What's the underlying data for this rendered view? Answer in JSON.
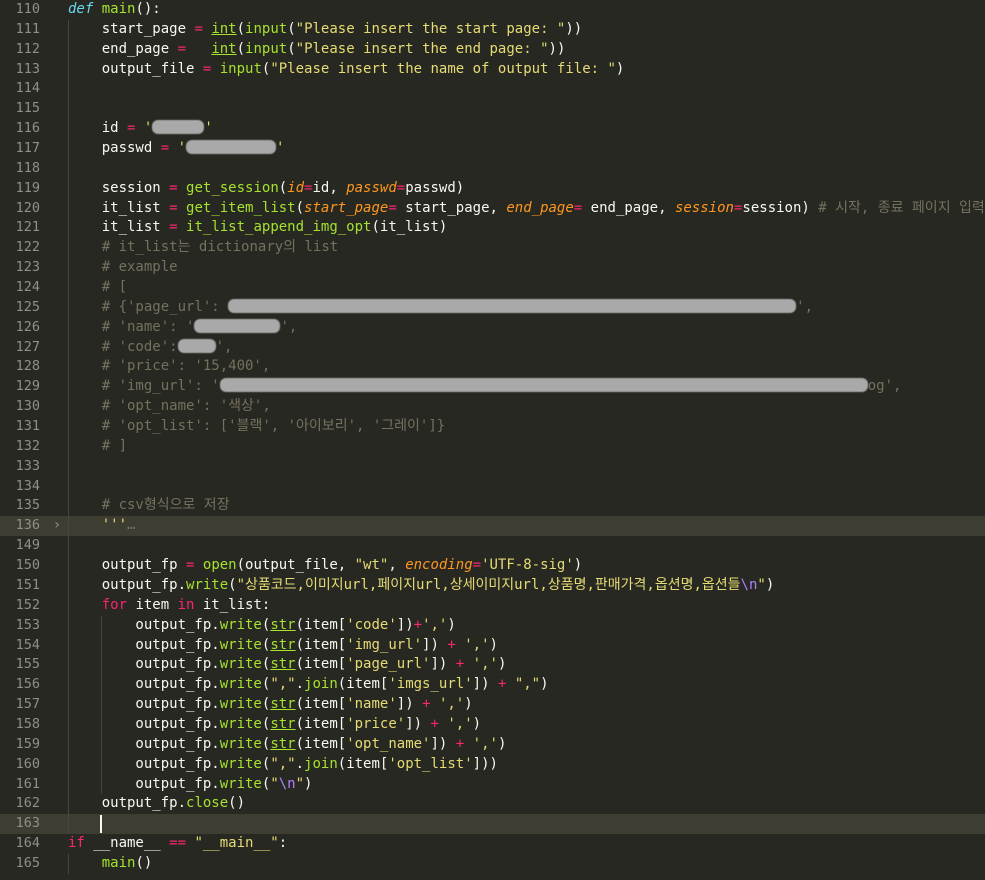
{
  "editor": {
    "first_line": "110",
    "lines": [
      {
        "n": "110",
        "t": [
          [
            "def",
            "kw-i"
          ],
          " ",
          [
            "main",
            "fn"
          ],
          "():"
        ]
      },
      {
        "n": "111",
        "t": [
          "    start_page ",
          [
            "=",
            "op"
          ],
          " ",
          [
            "int",
            "fn ul"
          ],
          "(",
          [
            "input",
            "fn"
          ],
          "(",
          [
            "\"Please insert the start page: \"",
            "str"
          ],
          "))"
        ]
      },
      {
        "n": "112",
        "t": [
          "    end_page ",
          [
            "=",
            "op"
          ],
          "   ",
          [
            "int",
            "fn ul"
          ],
          "(",
          [
            "input",
            "fn"
          ],
          "(",
          [
            "\"Please insert the end page: \"",
            "str"
          ],
          "))"
        ]
      },
      {
        "n": "113",
        "t": [
          "    output_file ",
          [
            "=",
            "op"
          ],
          " ",
          [
            "input",
            "fn"
          ],
          "(",
          [
            "\"Please insert the name of output file: \"",
            "str"
          ],
          ")"
        ]
      },
      {
        "n": "114",
        "t": []
      },
      {
        "n": "115",
        "t": []
      },
      {
        "n": "116",
        "t": [
          "    id ",
          [
            "=",
            "op"
          ],
          " ",
          [
            "'",
            "str"
          ],
          [
            "#R52",
            ""
          ],
          [
            "'",
            "str"
          ]
        ]
      },
      {
        "n": "117",
        "t": [
          "    passwd ",
          [
            "=",
            "op"
          ],
          " ",
          [
            "'",
            "str"
          ],
          [
            "#R90",
            ""
          ],
          [
            "'",
            "str"
          ]
        ]
      },
      {
        "n": "118",
        "t": []
      },
      {
        "n": "119",
        "t": [
          "    session ",
          [
            "=",
            "op"
          ],
          " ",
          [
            "get_session",
            "fn"
          ],
          "(",
          [
            "id",
            "arg"
          ],
          [
            "=",
            "op"
          ],
          "id, ",
          [
            "passwd",
            "arg"
          ],
          [
            "=",
            "op"
          ],
          "passwd)"
        ]
      },
      {
        "n": "120",
        "t": [
          "    it_list ",
          [
            "=",
            "op"
          ],
          " ",
          [
            "get_item_list",
            "fn"
          ],
          "(",
          [
            "start_page",
            "arg"
          ],
          [
            "=",
            "op"
          ],
          " start_page, ",
          [
            "end_page",
            "arg"
          ],
          [
            "=",
            "op"
          ],
          " end_page, ",
          [
            "session",
            "arg"
          ],
          [
            "=",
            "op"
          ],
          "session) ",
          [
            "# 시작, 종료 페이지 입력",
            "cm"
          ]
        ]
      },
      {
        "n": "121",
        "t": [
          "    it_list ",
          [
            "=",
            "op"
          ],
          " ",
          [
            "it_list_append_img_opt",
            "fn"
          ],
          "(it_list)"
        ]
      },
      {
        "n": "122",
        "t": [
          "    ",
          [
            "# it_list는 dictionary의 list",
            "cm"
          ]
        ]
      },
      {
        "n": "123",
        "t": [
          "    ",
          [
            "# example",
            "cm"
          ]
        ]
      },
      {
        "n": "124",
        "t": [
          "    ",
          [
            "# [",
            "cm"
          ]
        ]
      },
      {
        "n": "125",
        "t": [
          "    ",
          [
            "# {'page_url': ",
            "cm"
          ],
          [
            "#R568",
            ""
          ],
          [
            "',",
            "cm"
          ]
        ]
      },
      {
        "n": "126",
        "t": [
          "    ",
          [
            "# 'name': '",
            "cm"
          ],
          [
            "#R86",
            ""
          ],
          [
            "',",
            "cm"
          ]
        ]
      },
      {
        "n": "127",
        "t": [
          "    ",
          [
            "# 'code':",
            "cm"
          ],
          [
            "#R38",
            ""
          ],
          [
            "',",
            "cm"
          ]
        ]
      },
      {
        "n": "128",
        "t": [
          "    ",
          [
            "# 'price': '15,400',",
            "cm"
          ]
        ]
      },
      {
        "n": "129",
        "t": [
          "    ",
          [
            "# 'img_url': '",
            "cm"
          ],
          [
            "#R648",
            ""
          ],
          [
            "og',",
            "cm"
          ]
        ]
      },
      {
        "n": "130",
        "t": [
          "    ",
          [
            "# 'opt_name': '색상',",
            "cm"
          ]
        ]
      },
      {
        "n": "131",
        "t": [
          "    ",
          [
            "# 'opt_list': ['블랙', '아이보리', '그레이']}",
            "cm"
          ]
        ]
      },
      {
        "n": "132",
        "t": [
          "    ",
          [
            "# ]",
            "cm"
          ]
        ]
      },
      {
        "n": "133",
        "t": []
      },
      {
        "n": "134",
        "t": []
      },
      {
        "n": "135",
        "t": [
          "    ",
          [
            "# csv형식으로 저장",
            "cm"
          ]
        ]
      },
      {
        "n": "136",
        "t": [
          "    ",
          [
            "'''",
            "str"
          ],
          [
            "…",
            "cm"
          ]
        ],
        "fold": true,
        "hl": true
      },
      {
        "n": "149",
        "t": []
      },
      {
        "n": "150",
        "t": [
          "    output_fp ",
          [
            "=",
            "op"
          ],
          " ",
          [
            "open",
            "fn"
          ],
          "(output_file, ",
          [
            "\"wt\"",
            "str"
          ],
          ", ",
          [
            "encoding",
            "arg"
          ],
          [
            "=",
            "op"
          ],
          [
            "'UTF-8-sig'",
            "str"
          ],
          ")"
        ]
      },
      {
        "n": "151",
        "t": [
          "    output_fp.",
          [
            "write",
            "fn"
          ],
          "(",
          [
            "\"상품코드,이미지url,페이지url,상세이미지url,상품명,판매가격,옵션명,옵션들",
            "str"
          ],
          [
            "\\n",
            "esc"
          ],
          [
            "\"",
            "str"
          ],
          ")"
        ]
      },
      {
        "n": "152",
        "t": [
          "    ",
          [
            "for",
            "kw"
          ],
          " item ",
          [
            "in",
            "kw"
          ],
          " it_list:"
        ]
      },
      {
        "n": "153",
        "t": [
          "        output_fp.",
          [
            "write",
            "fn"
          ],
          "(",
          [
            "str",
            "fn ul"
          ],
          "(item[",
          [
            "'code'",
            "str"
          ],
          "])",
          [
            "+",
            "op"
          ],
          [
            "','",
            "str"
          ],
          ")"
        ]
      },
      {
        "n": "154",
        "t": [
          "        output_fp.",
          [
            "write",
            "fn"
          ],
          "(",
          [
            "str",
            "fn ul"
          ],
          "(item[",
          [
            "'img_url'",
            "str"
          ],
          "]) ",
          [
            "+",
            "op"
          ],
          " ",
          [
            "','",
            "str"
          ],
          ")"
        ]
      },
      {
        "n": "155",
        "t": [
          "        output_fp.",
          [
            "write",
            "fn"
          ],
          "(",
          [
            "str",
            "fn ul"
          ],
          "(item[",
          [
            "'page_url'",
            "str"
          ],
          "]) ",
          [
            "+",
            "op"
          ],
          " ",
          [
            "','",
            "str"
          ],
          ")"
        ]
      },
      {
        "n": "156",
        "t": [
          "        output_fp.",
          [
            "write",
            "fn"
          ],
          "(",
          [
            "\",\"",
            "str"
          ],
          ".",
          [
            "join",
            "fn"
          ],
          "(item[",
          [
            "'imgs_url'",
            "str"
          ],
          "]) ",
          [
            "+",
            "op"
          ],
          " ",
          [
            "\",\"",
            "str"
          ],
          ")"
        ]
      },
      {
        "n": "157",
        "t": [
          "        output_fp.",
          [
            "write",
            "fn"
          ],
          "(",
          [
            "str",
            "fn ul"
          ],
          "(item[",
          [
            "'name'",
            "str"
          ],
          "]) ",
          [
            "+",
            "op"
          ],
          " ",
          [
            "','",
            "str"
          ],
          ")"
        ]
      },
      {
        "n": "158",
        "t": [
          "        output_fp.",
          [
            "write",
            "fn"
          ],
          "(",
          [
            "str",
            "fn ul"
          ],
          "(item[",
          [
            "'price'",
            "str"
          ],
          "]) ",
          [
            "+",
            "op"
          ],
          " ",
          [
            "','",
            "str"
          ],
          ")"
        ]
      },
      {
        "n": "159",
        "t": [
          "        output_fp.",
          [
            "write",
            "fn"
          ],
          "(",
          [
            "str",
            "fn ul"
          ],
          "(item[",
          [
            "'opt_name'",
            "str"
          ],
          "]) ",
          [
            "+",
            "op"
          ],
          " ",
          [
            "','",
            "str"
          ],
          ")"
        ]
      },
      {
        "n": "160",
        "t": [
          "        output_fp.",
          [
            "write",
            "fn"
          ],
          "(",
          [
            "\",\"",
            "str"
          ],
          ".",
          [
            "join",
            "fn"
          ],
          "(item[",
          [
            "'opt_list'",
            "str"
          ],
          "]))"
        ]
      },
      {
        "n": "161",
        "t": [
          "        output_fp.",
          [
            "write",
            "fn"
          ],
          "(",
          [
            "\"",
            "str"
          ],
          [
            "\\n",
            "esc"
          ],
          [
            "\"",
            "str"
          ],
          ")"
        ]
      },
      {
        "n": "162",
        "t": [
          "    output_fp.",
          [
            "close",
            "fn"
          ],
          "()"
        ]
      },
      {
        "n": "163",
        "t": [],
        "hl": true,
        "cursor": true
      },
      {
        "n": "164",
        "t": [
          [
            "if",
            "kw"
          ],
          " __name__ ",
          [
            "==",
            "op"
          ],
          " ",
          [
            "\"__main__\"",
            "str"
          ],
          ":"
        ]
      },
      {
        "n": "165",
        "t": [
          "    ",
          [
            "main",
            "fn"
          ],
          "()"
        ]
      }
    ]
  },
  "colors": {
    "background": "#272822",
    "keyword": "#f92672",
    "function": "#a6e22e",
    "string": "#e6db74",
    "comment": "#75715e",
    "argument": "#fd971f"
  }
}
